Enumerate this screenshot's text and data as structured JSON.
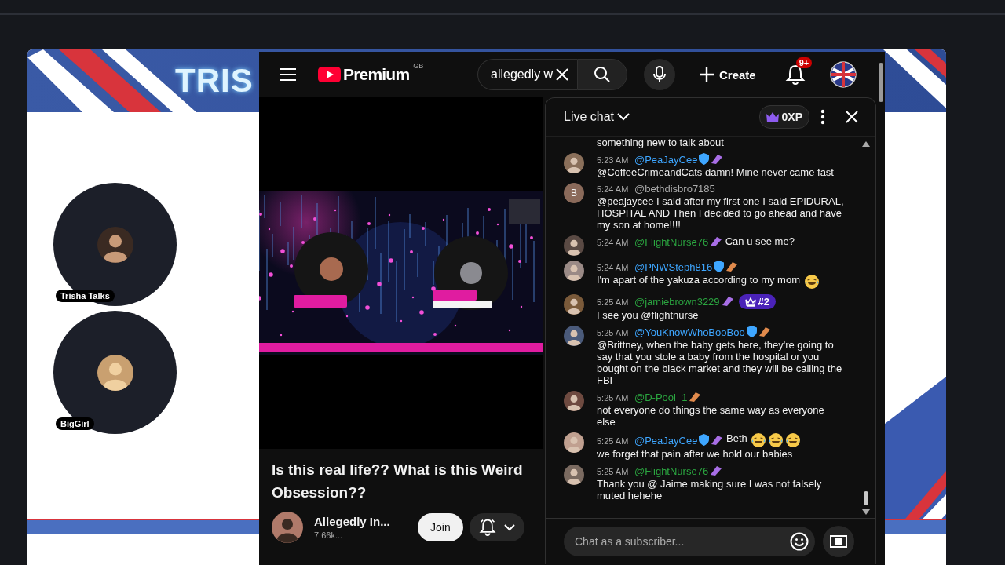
{
  "stream_layout": {
    "banner_text": "TRIS",
    "participants": [
      {
        "name": "Trisha Talks"
      },
      {
        "name": "BigGirl"
      }
    ]
  },
  "youtube": {
    "logo": {
      "text": "Premium",
      "country": "GB"
    },
    "search": {
      "value": "allegedly w"
    },
    "create_label": "Create",
    "notifications_badge": "9+",
    "video": {
      "kind": "picture",
      "title": "Is this real life?? What is this Weird Obsession??",
      "channel": {
        "name": "Allegedly In...",
        "subscribers": "7.66k..."
      },
      "join_label": "Join"
    },
    "live_chat": {
      "title": "Live chat",
      "xp": "0XP",
      "messages": [
        {
          "kind": "continuation",
          "parts": [
            {
              "kind": "text",
              "text": "something new to talk about"
            }
          ]
        },
        {
          "kind": "message",
          "time": "5:23 AM",
          "author": "@PeaJayCee",
          "color": "#3ea6ff",
          "verified": true,
          "badge": {
            "color": "#a86ee6"
          },
          "parts": [
            {
              "kind": "text",
              "text": "@CoffeeCrimeandCats damn! Mine never came fast"
            }
          ]
        },
        {
          "kind": "message",
          "time": "5:24 AM",
          "author": "@bethdisbro7185",
          "color": "#aaaaaa",
          "verified": false,
          "avatar_letter": "B",
          "parts": [
            {
              "kind": "text",
              "text": "@peajaycee I said after my first one I said EPIDURAL, HOSPITAL AND Then I decided to go ahead and have my son at home!!!!"
            }
          ]
        },
        {
          "kind": "message",
          "time": "5:24 AM",
          "author": "@FlightNurse76",
          "color": "#2ba640",
          "verified": false,
          "badge": {
            "color": "#a86ee6"
          },
          "parts": [
            {
              "kind": "text",
              "text": "Can u see me?"
            }
          ]
        },
        {
          "kind": "message",
          "time": "5:24 AM",
          "author": "@PNWSteph816",
          "color": "#3ea6ff",
          "verified": true,
          "badge": {
            "color": "#e08a4c"
          },
          "parts": [
            {
              "kind": "text",
              "text": "I'm apart of the yakuza according to my mom"
            },
            {
              "kind": "emoji"
            }
          ]
        },
        {
          "kind": "message",
          "time": "5:25 AM",
          "author": "@jamiebrown3229",
          "color": "#2ba640",
          "verified": false,
          "badge": {
            "color": "#a86ee6"
          },
          "rank": "#2",
          "parts": [
            {
              "kind": "text",
              "text": "I see you @flightnurse"
            }
          ]
        },
        {
          "kind": "message",
          "time": "5:25 AM",
          "author": "@YouKnowWhoBooBoo",
          "color": "#3ea6ff",
          "verified": true,
          "badge": {
            "color": "#e08a4c"
          },
          "parts": [
            {
              "kind": "text",
              "text": "@Brittney, when the baby gets here, they're going to say that you stole a baby from the hospital or you bought on the black market and they will be calling the FBI"
            }
          ]
        },
        {
          "kind": "message",
          "time": "5:25 AM",
          "author": "@D-Pool_1",
          "color": "#2ba640",
          "verified": false,
          "badge": {
            "color": "#e08a4c"
          },
          "parts": [
            {
              "kind": "text",
              "text": "not everyone do things the same way as everyone else"
            }
          ]
        },
        {
          "kind": "message",
          "time": "5:25 AM",
          "author": "@PeaJayCee",
          "color": "#3ea6ff",
          "verified": true,
          "badge": {
            "color": "#a86ee6"
          },
          "parts": [
            {
              "kind": "text",
              "text": "Beth"
            },
            {
              "kind": "emoji"
            },
            {
              "kind": "emoji"
            },
            {
              "kind": "emoji"
            },
            {
              "kind": "text",
              "text": "we forget that pain after we hold our babies"
            }
          ]
        },
        {
          "kind": "message",
          "time": "5:25 AM",
          "author": "@FlightNurse76",
          "color": "#2ba640",
          "verified": false,
          "badge": {
            "color": "#a86ee6"
          },
          "parts": [
            {
              "kind": "text",
              "text": "Thank you @ Jaime making sure I was not falsely muted hehehe"
            }
          ]
        }
      ],
      "input": {
        "placeholder": "Chat as a subscriber..."
      }
    }
  }
}
